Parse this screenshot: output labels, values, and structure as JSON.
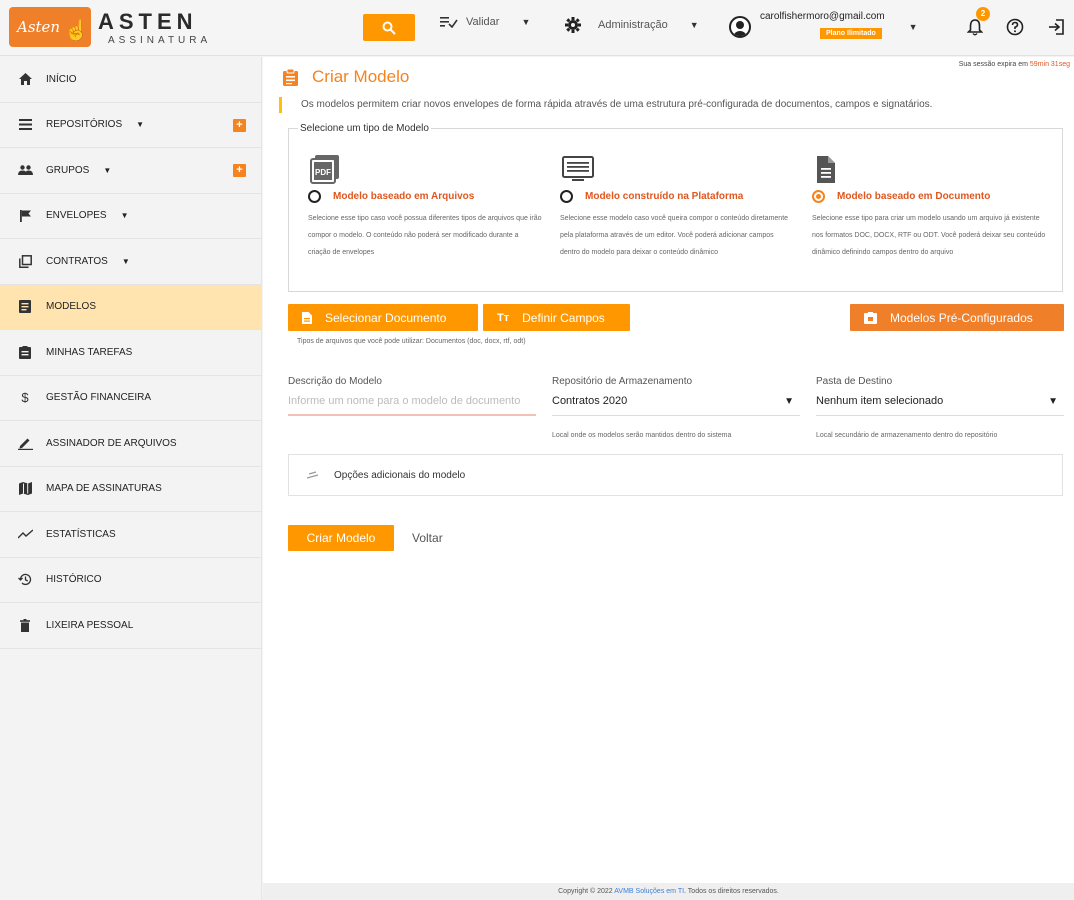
{
  "header": {
    "logo_script": "Asten",
    "logo_main": "ASTEN",
    "logo_sub": "ASSINATURA",
    "nav_validar": "Validar",
    "nav_admin": "Administração",
    "user_email": "carolfishermoro@gmail.com",
    "plan_badge": "Plano Ilimitado",
    "notifications_count": "2"
  },
  "sidebar": {
    "items": [
      {
        "label": "INÍCIO",
        "icon": "home-icon"
      },
      {
        "label": "REPOSITÓRIOS",
        "icon": "list-icon"
      },
      {
        "label": "GRUPOS",
        "icon": "group-icon"
      },
      {
        "label": "ENVELOPES",
        "icon": "flag-icon"
      },
      {
        "label": "CONTRATOS",
        "icon": "copy-icon"
      },
      {
        "label": "MODELOS",
        "icon": "template-icon"
      },
      {
        "label": "MINHAS TAREFAS",
        "icon": "tasks-icon"
      },
      {
        "label": "GESTÃO FINANCEIRA",
        "icon": "dollar-icon"
      },
      {
        "label": "ASSINADOR DE ARQUIVOS",
        "icon": "pen-icon"
      },
      {
        "label": "MAPA DE ASSINATURAS",
        "icon": "map-icon"
      },
      {
        "label": "ESTATÍSTICAS",
        "icon": "chart-line-icon"
      },
      {
        "label": "HISTÓRICO",
        "icon": "history-icon"
      },
      {
        "label": "LIXEIRA PESSOAL",
        "icon": "trash-icon"
      }
    ]
  },
  "main": {
    "session_prefix": "Sua sessão expira em",
    "session_time": "59min 31seg",
    "title": "Criar Modelo",
    "info": "Os modelos permitem criar novos envelopes de forma rápida através de uma estrutura pré-configurada de documentos, campos e signatários.",
    "type_legend": "Selecione um tipo de Modelo",
    "options": [
      {
        "label": "Modelo baseado em Arquivos",
        "desc": "Selecione esse tipo caso você possua diferentes tipos de arquivos que irão compor o modelo. O conteúdo não poderá ser modificado durante a criação de envelopes",
        "selected": false
      },
      {
        "label": "Modelo construído na Plataforma",
        "desc": "Selecione esse modelo caso você queira compor o conteúdo diretamente pela plataforma através de um editor. Você poderá adicionar campos dentro do modelo para deixar o conteúdo dinâmico",
        "selected": false
      },
      {
        "label": "Modelo baseado em Documento",
        "desc": "Selecione esse tipo para criar um modelo usando um arquivo já existente nos formatos DOC, DOCX, RTF ou ODT. Você poderá deixar seu conteúdo dinâmico definindo campos dentro do arquivo",
        "selected": true
      }
    ],
    "btn_select_doc": "Selecionar Documento",
    "btn_define_fields": "Definir Campos",
    "btn_preconfigured": "Modelos Pré-Configurados",
    "file_types_hint": "Tipos de arquivos que você pode utilizar: Documentos (doc, docx, rtf, odt)",
    "desc_label": "Descrição do Modelo",
    "desc_placeholder": "Informe um nome para o modelo de documento",
    "repo_label": "Repositório de Armazenamento",
    "repo_value": "Contratos 2020",
    "repo_hint": "Local onde os modelos serão mantidos dentro do sistema",
    "folder_label": "Pasta de Destino",
    "folder_value": "Nenhum item selecionado",
    "folder_hint": "Local secundário de armazenamento dentro do repositório",
    "extra_options": "Opções adicionais do modelo",
    "btn_create": "Criar Modelo",
    "btn_back": "Voltar"
  },
  "footer": {
    "prefix": "Copyright © 2022",
    "link": "AVMB Soluções em TI",
    "suffix": ". Todos os direitos reservados."
  },
  "colors": {
    "accent": "#ff9800",
    "brand": "#f07f2a",
    "title": "#f5831f",
    "active_bg": "#ffe4b0"
  }
}
